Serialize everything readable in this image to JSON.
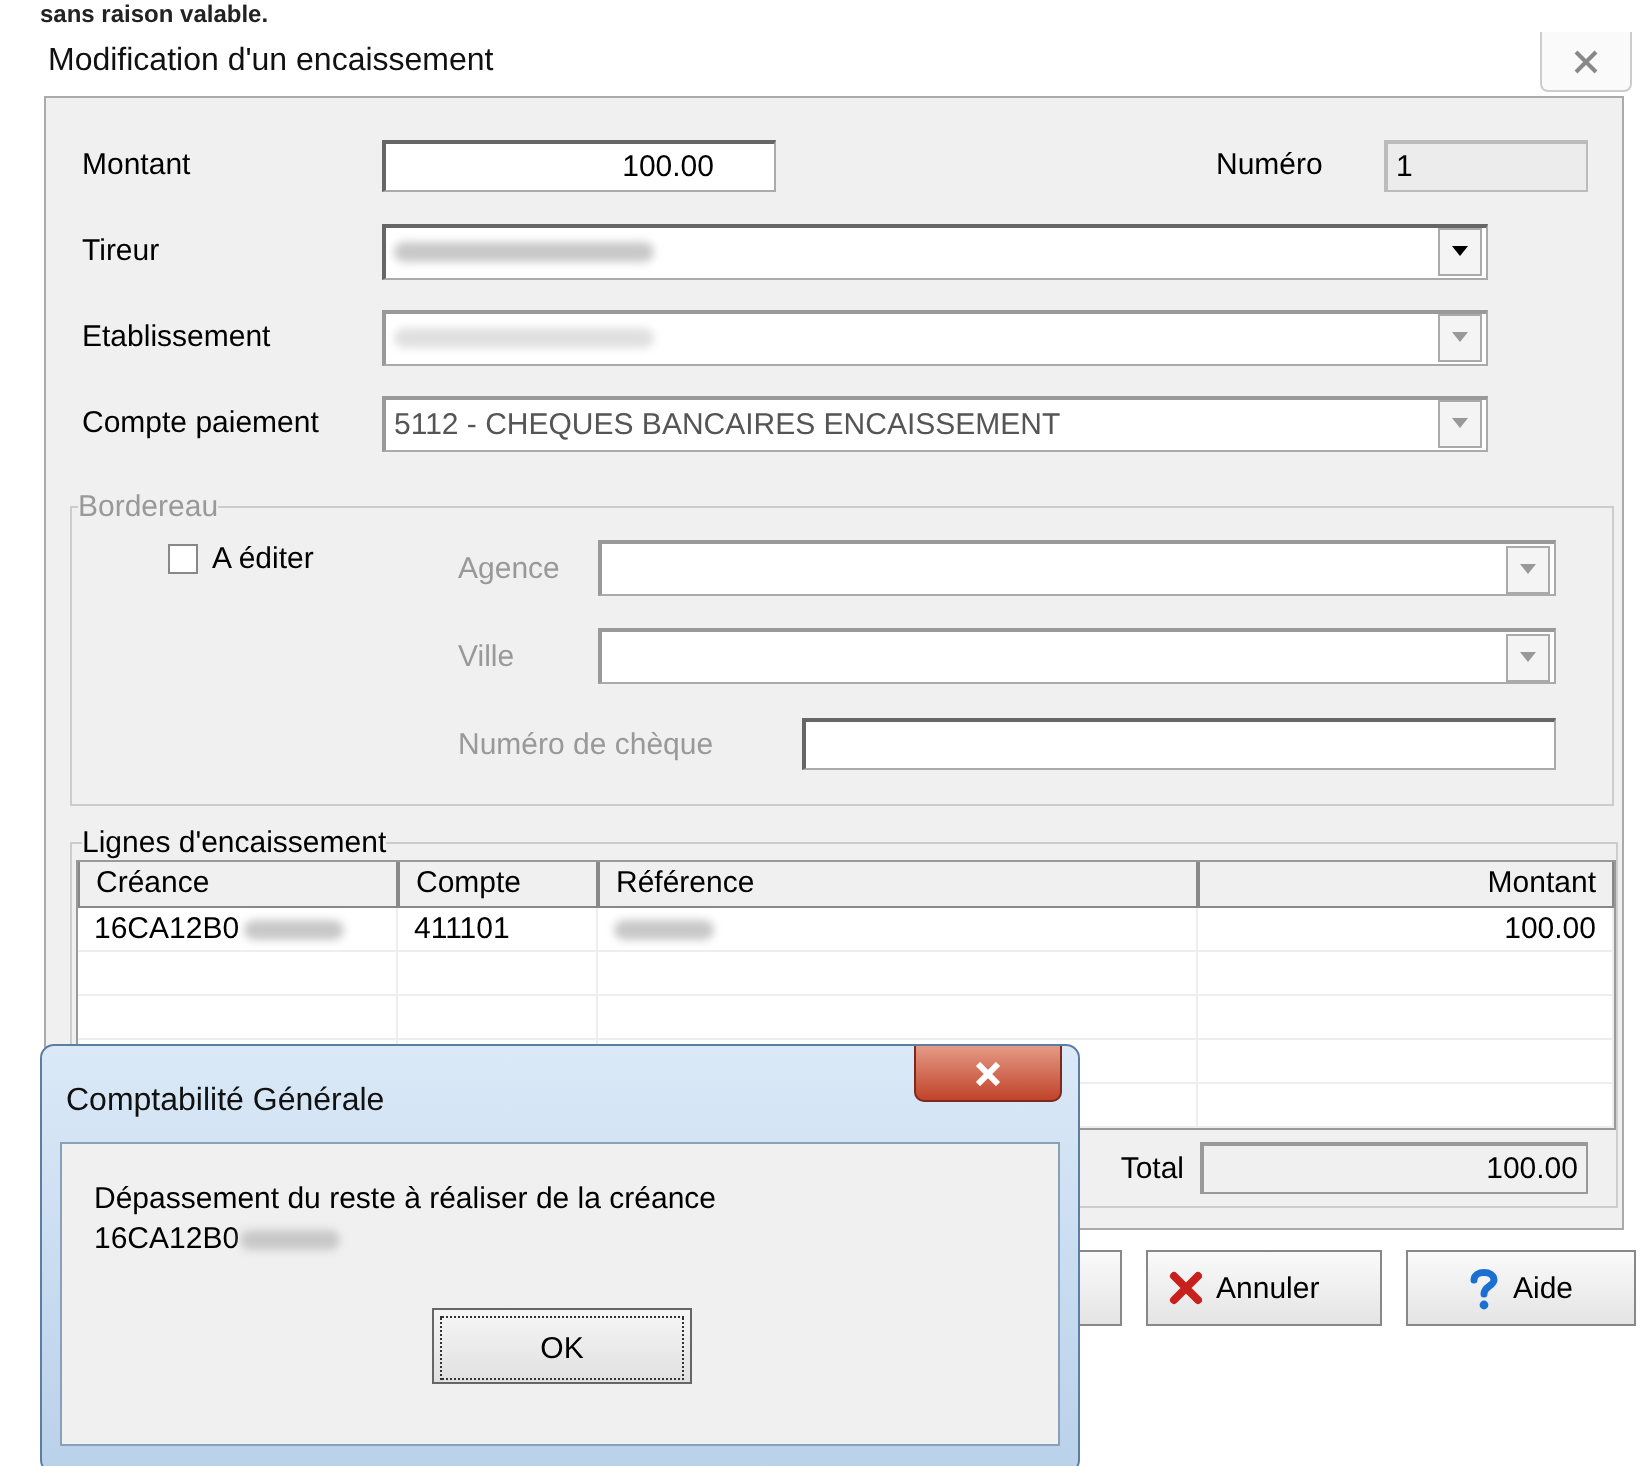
{
  "caption": "sans raison valable.",
  "window": {
    "title": "Modification d'un encaissement"
  },
  "top_fields": [
    {
      "label": "Montant",
      "kind": "text",
      "value": "100.00"
    },
    {
      "label": "Tireur",
      "kind": "combo",
      "disabled": false,
      "redacted": true
    },
    {
      "label": "Etablissement",
      "kind": "combo",
      "disabled": true,
      "redacted": true
    },
    {
      "label": "Compte paiement",
      "kind": "combo",
      "disabled": true,
      "value": "5112 - CHEQUES BANCAIRES ENCAISSEMENT"
    }
  ],
  "numero": {
    "label": "Numéro",
    "value": "1"
  },
  "bordereau": {
    "title": "Bordereau",
    "disabled": true,
    "checkbox": {
      "label": "A éditer",
      "checked": false
    },
    "fields": [
      {
        "label": "Agence",
        "kind": "combo"
      },
      {
        "label": "Ville",
        "kind": "combo"
      },
      {
        "label": "Numéro de chèque",
        "kind": "text"
      }
    ]
  },
  "lignes": {
    "title": "Lignes d'encaissement",
    "columns": [
      "Créance",
      "Compte",
      "Référence",
      "Montant"
    ],
    "rows": [
      {
        "cells": [
          {
            "text": "16CA12B0",
            "redacted": true
          },
          {
            "text": "411101"
          },
          {
            "redacted": true
          },
          {
            "text": "100.00"
          }
        ]
      }
    ],
    "total_label": "Total",
    "total_value": "100.00"
  },
  "buttons": [
    {
      "label": "Annuler",
      "kind": "cancel"
    },
    {
      "label": "Aide",
      "kind": "help"
    }
  ],
  "dialog": {
    "title": "Comptabilité Générale",
    "message": [
      "Dépassement du reste à réaliser de la créance",
      {
        "text": "16CA12B0",
        "redacted": true
      }
    ],
    "button": "OK"
  }
}
